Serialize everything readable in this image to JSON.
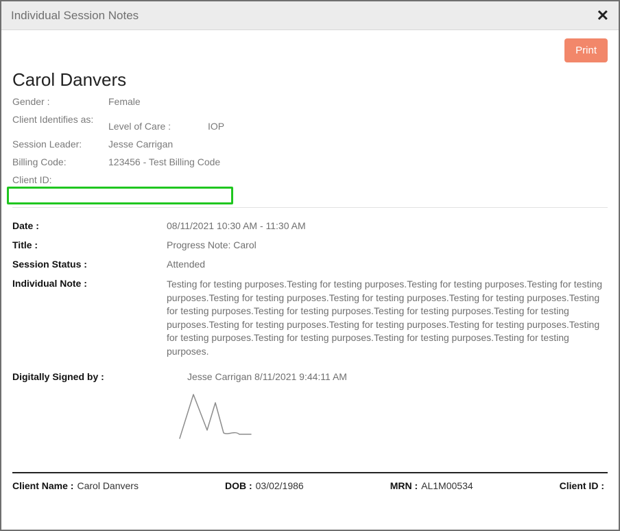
{
  "window": {
    "title": "Individual Session Notes"
  },
  "actions": {
    "print_label": "Print"
  },
  "client": {
    "name": "Carol Danvers",
    "gender_label": "Gender :",
    "gender": "Female",
    "identifies_label": "Client Identifies as:",
    "identifies": "",
    "loc_label": "Level of Care :",
    "loc": "IOP",
    "session_leader_label": "Session Leader:",
    "session_leader": "Jesse Carrigan",
    "billing_code_label": "Billing Code:",
    "billing_code": "123456 - Test Billing Code",
    "client_id_label": "Client ID:",
    "client_id": ""
  },
  "session": {
    "date_label": "Date :",
    "date": "08/11/2021 10:30 AM - 11:30 AM",
    "title_label": "Title :",
    "title": "Progress Note: Carol",
    "status_label": "Session Status :",
    "status": "Attended",
    "note_label": "Individual Note :",
    "note": "Testing for testing purposes.Testing for testing purposes.Testing for testing purposes.Testing for testing purposes.Testing for testing purposes.Testing for testing purposes.Testing for testing purposes.Testing for testing purposes.Testing for testing purposes.Testing for testing purposes.Testing for testing purposes.Testing for testing purposes.Testing for testing purposes.Testing for testing purposes.Testing for testing purposes.Testing for testing purposes.Testing for testing purposes.Testing for testing purposes."
  },
  "signature": {
    "label": "Digitally Signed by :",
    "value": "Jesse Carrigan 8/11/2021 9:44:11 AM"
  },
  "footer": {
    "client_name_label": "Client Name :",
    "client_name": "Carol Danvers",
    "dob_label": "DOB :",
    "dob": "03/02/1986",
    "mrn_label": "MRN :",
    "mrn": "AL1M00534",
    "client_id_label": "Client ID :",
    "client_id": ""
  }
}
